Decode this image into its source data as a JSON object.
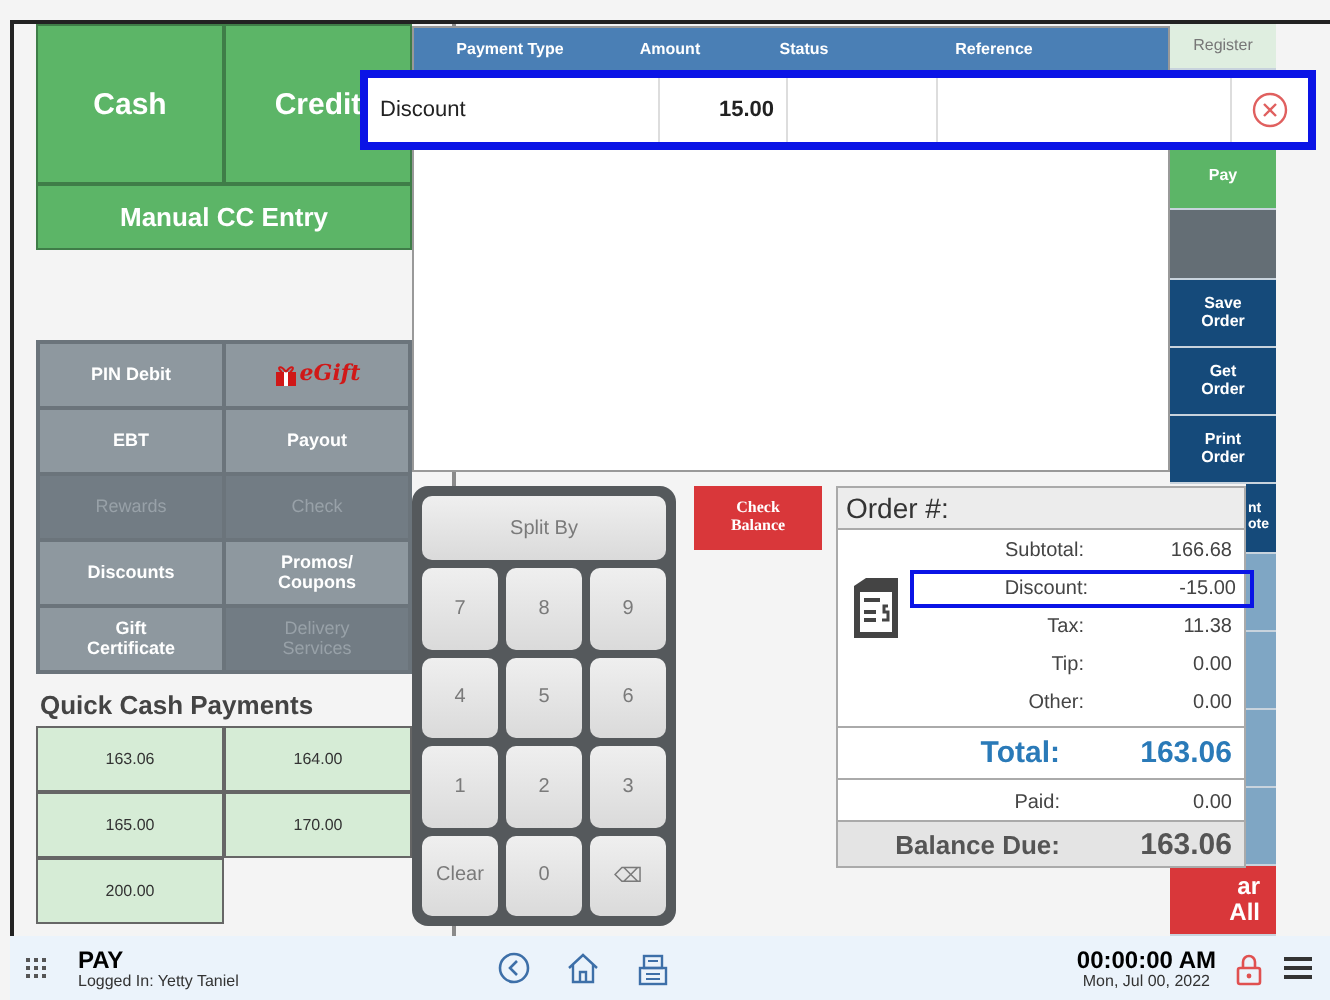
{
  "payment_buttons": [
    {
      "label": "Cash",
      "kind": "large"
    },
    {
      "label": "Credit",
      "kind": "large"
    },
    {
      "label": "Manual CC Entry",
      "kind": "wide"
    }
  ],
  "tender_buttons": [
    {
      "label": "PIN Debit",
      "kind": "text",
      "disabled": false
    },
    {
      "label": "eGift",
      "kind": "logo",
      "disabled": false
    },
    {
      "label": "EBT",
      "kind": "text",
      "disabled": false
    },
    {
      "label": "Payout",
      "kind": "text",
      "disabled": false
    },
    {
      "label": "Rewards",
      "kind": "text",
      "disabled": true
    },
    {
      "label": "Check",
      "kind": "text",
      "disabled": true
    },
    {
      "label": "Discounts",
      "kind": "text",
      "disabled": false
    },
    {
      "label": "Promos/\nCoupons",
      "kind": "text",
      "disabled": false
    },
    {
      "label": "Gift\nCertificate",
      "kind": "text",
      "disabled": false
    },
    {
      "label": "Delivery\nServices",
      "kind": "text",
      "disabled": true
    }
  ],
  "quick_cash": {
    "title": "Quick Cash Payments",
    "amounts": [
      "163.06",
      "164.00",
      "165.00",
      "170.00",
      "200.00"
    ]
  },
  "payments_table": {
    "columns": [
      "Payment Type",
      "Amount",
      "Status",
      "Reference"
    ],
    "rows": [
      {
        "payment_type": "Discount",
        "amount": "15.00",
        "highlighted": true
      }
    ]
  },
  "sidebar": [
    {
      "kind": "light",
      "label": "Register"
    },
    {
      "kind": "hidden"
    },
    {
      "kind": "green",
      "label": "Pay"
    },
    {
      "kind": "grey"
    },
    {
      "kind": "navy",
      "label": "Save\nOrder"
    },
    {
      "kind": "navy",
      "label": "Get\nOrder"
    },
    {
      "kind": "navy",
      "label": "Print\nOrder"
    },
    {
      "kind": "navy",
      "label": "nt\note"
    },
    {
      "kind": "pale"
    },
    {
      "kind": "pale"
    },
    {
      "kind": "pale"
    },
    {
      "kind": "pale"
    },
    {
      "kind": "red",
      "label": "ar\nAll"
    }
  ],
  "keypad": {
    "keys": [
      {
        "label": "Split By",
        "kind": "wide",
        "disabled": true
      },
      {
        "label": "7",
        "kind": "key",
        "disabled": true
      },
      {
        "label": "8",
        "kind": "key",
        "disabled": true
      },
      {
        "label": "9",
        "kind": "key",
        "disabled": true
      },
      {
        "label": "4",
        "kind": "key",
        "disabled": true
      },
      {
        "label": "5",
        "kind": "key",
        "disabled": true
      },
      {
        "label": "6",
        "kind": "key",
        "disabled": true
      },
      {
        "label": "1",
        "kind": "key",
        "disabled": true
      },
      {
        "label": "2",
        "kind": "key",
        "disabled": true
      },
      {
        "label": "3",
        "kind": "key",
        "disabled": true
      },
      {
        "label": "Clear",
        "kind": "key",
        "disabled": true
      },
      {
        "label": "0",
        "kind": "key",
        "disabled": true
      },
      {
        "label": "⌫",
        "kind": "key",
        "disabled": true
      }
    ]
  },
  "check_balance": "Check\nBalance",
  "order": {
    "title": "Order #:",
    "lines": [
      {
        "label": "Subtotal:",
        "value": "166.68",
        "highlighted": false
      },
      {
        "label": "Discount:",
        "value": "-15.00",
        "highlighted": true
      },
      {
        "label": "Tax:",
        "value": "11.38",
        "highlighted": false
      },
      {
        "label": "Tip:",
        "value": "0.00",
        "highlighted": false
      },
      {
        "label": "Other:",
        "value": "0.00",
        "highlighted": false
      }
    ],
    "total_label": "Total:",
    "total": "163.06",
    "paid_label": "Paid:",
    "paid": "0.00",
    "balance_label": "Balance Due:",
    "balance": "163.06"
  },
  "status_bar": {
    "screen": "PAY",
    "user": "Logged In:  Yetty Taniel",
    "time": "00:00:00 AM",
    "date": "Mon, Jul 00, 2022"
  }
}
